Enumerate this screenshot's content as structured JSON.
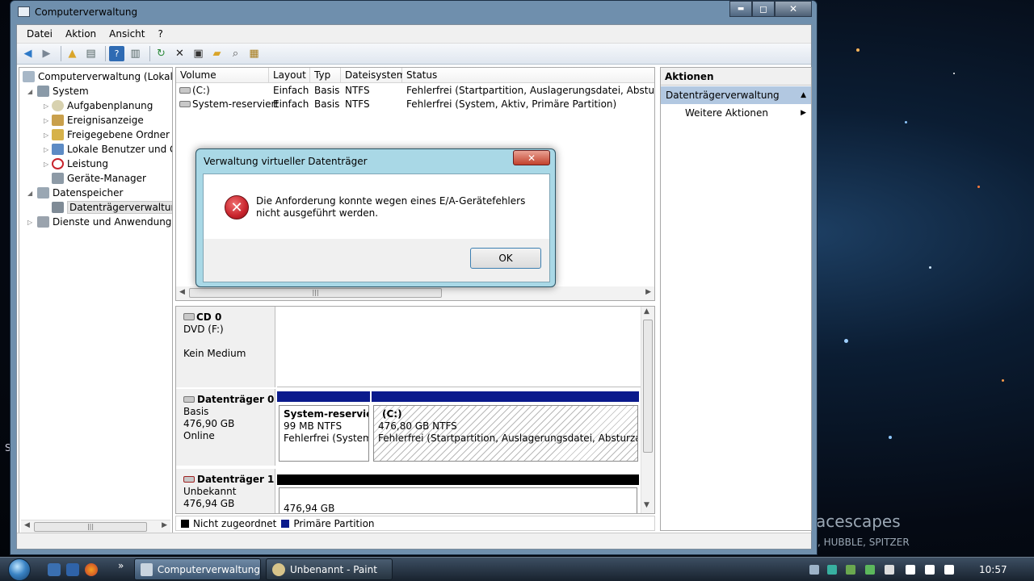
{
  "window": {
    "title": "Computerverwaltung",
    "controls": {
      "minimize": "▬",
      "maximize": "◻",
      "close": "✕"
    }
  },
  "menu": [
    "Datei",
    "Aktion",
    "Ansicht",
    "?"
  ],
  "tree": {
    "items": [
      {
        "label": "Computerverwaltung (Lokal)",
        "icon": "computer-management-icon"
      },
      {
        "label": "System",
        "icon": "system-tools-icon"
      },
      {
        "label": "Aufgabenplanung",
        "icon": "task-scheduler-icon"
      },
      {
        "label": "Ereignisanzeige",
        "icon": "event-viewer-icon"
      },
      {
        "label": "Freigegebene Ordner",
        "icon": "shared-folders-icon"
      },
      {
        "label": "Lokale Benutzer und Gruppen",
        "icon": "local-users-icon"
      },
      {
        "label": "Leistung",
        "icon": "performance-icon"
      },
      {
        "label": "Geräte-Manager",
        "icon": "device-manager-icon"
      },
      {
        "label": "Datenspeicher",
        "icon": "storage-icon"
      },
      {
        "label": "Datenträgerverwaltung",
        "icon": "disk-management-icon"
      },
      {
        "label": "Dienste und Anwendungen",
        "icon": "services-icon"
      }
    ]
  },
  "volumes": {
    "columns": [
      "Volume",
      "Layout",
      "Typ",
      "Dateisystem",
      "Status"
    ],
    "rows": [
      {
        "volume": "(C:)",
        "layout": "Einfach",
        "typ": "Basis",
        "fs": "NTFS",
        "status": "Fehlerfrei (Startpartition, Auslagerungsdatei, Absturzabbild"
      },
      {
        "volume": "System-reserviert",
        "layout": "Einfach",
        "typ": "Basis",
        "fs": "NTFS",
        "status": "Fehlerfrei (System, Aktiv, Primäre Partition)"
      }
    ]
  },
  "disks": {
    "cd0": {
      "name": "CD 0",
      "type": "DVD (F:)",
      "media": "Kein Medium"
    },
    "disk0": {
      "name": "Datenträger 0",
      "kind": "Basis",
      "size": "476,90 GB",
      "state": "Online",
      "p1": {
        "name": "System-reserviert",
        "size": "99 MB NTFS",
        "status": "Fehlerfrei (System, ."
      },
      "p2": {
        "name": "(C:)",
        "size": "476,80 GB NTFS",
        "status": "Fehlerfrei (Startpartition, Auslagerungsdatei, Absturzabbild, P"
      }
    },
    "disk1": {
      "name": "Datenträger 1",
      "kind": "Unbekannt",
      "size": "476,94 GB",
      "area_size": "476,94 GB"
    }
  },
  "legend": [
    {
      "label": "Nicht zugeordnet",
      "color": "#000000"
    },
    {
      "label": "Primäre Partition",
      "color": "#0a1a8c"
    }
  ],
  "actions": {
    "header": "Aktionen",
    "section": "Datenträgerverwaltung",
    "item": "Weitere Aktionen"
  },
  "dialog": {
    "title": "Verwaltung virtueller Datenträger",
    "message": "Die Anforderung konnte wegen eines E/A-Gerätefehlers nicht ausgeführt werden.",
    "ok": "OK",
    "close": "✕"
  },
  "taskbar": {
    "tasks": [
      "Computerverwaltung",
      "Unbenannt - Paint"
    ],
    "overflow": "»",
    "clock": "10:57"
  },
  "wallpaper": {
    "caption": "acescapes",
    "caption2": ", HUBBLE, SPITZER",
    "edge_letter": "S"
  },
  "colors": {
    "primary_partition": "#0a1a8c",
    "unallocated": "#000000",
    "selection": "#b2c8e1",
    "error": "#c8232c"
  }
}
